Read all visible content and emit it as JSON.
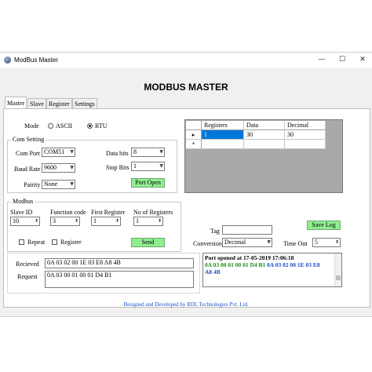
{
  "window": {
    "title": "ModBus Master",
    "controls": {
      "minimize": "—",
      "maximize": "☐",
      "close": "✕"
    }
  },
  "heading": "MODBUS MASTER",
  "tabs": [
    "Master",
    "Slave",
    "Register",
    "Settings"
  ],
  "mode": {
    "label": "Mode",
    "ascii": "ASCII",
    "rtu": "RTU",
    "selected": "RTU"
  },
  "com_setting": {
    "title": "Com Setting",
    "com_port_label": "Com Port",
    "com_port": "COM51",
    "baud_rate_label": "Baud Rate",
    "baud_rate": "9600",
    "pairity_label": "Pairity",
    "pairity": "None",
    "data_bits_label": "Data bits",
    "data_bits": "8",
    "stop_bits_label": "Stop Bits",
    "stop_bits": "1",
    "port_open_label": "Port Open"
  },
  "modbus": {
    "title": "Modbus",
    "slave_id_label": "Slave ID",
    "slave_id": "10",
    "function_code_label": "Function code",
    "function_code": "3",
    "first_register_label": "First Register",
    "first_register": "1",
    "no_of_registers_label": "No of Registers",
    "no_of_registers": "1",
    "repeat_label": "Repeat",
    "register_label": "Register",
    "send_label": "Send"
  },
  "grid": {
    "columns": [
      "Registers",
      "Data",
      "Decimal"
    ],
    "rows": [
      {
        "registers": "1",
        "data": "30",
        "decimal": "30"
      }
    ],
    "current_row_marker": "▸",
    "new_row_marker": "*"
  },
  "save_log_label": "Save Log",
  "tag": {
    "label": "Tag",
    "value": ""
  },
  "conversion": {
    "label": "Conversion",
    "value": "Decimal"
  },
  "time_out": {
    "label": "Time Out",
    "value": "5"
  },
  "recieved": {
    "label": "Recieved",
    "value": "0A 03 02 00 1E 03 E8 A8 4B"
  },
  "request": {
    "label": "Request",
    "value": "0A 03 00 01 00 01 D4 B1"
  },
  "log": {
    "line1": "Port opened at 17-05-2019 17:06:18",
    "line2_green": "0A 03 00 01 00 01 D4 B1",
    "line2_blue": "0A 03 02 00 1E 03 E8",
    "line3": "A8 4B"
  },
  "footer": "Designed and Developed by RDL Technologies Pvt. Ltd.",
  "colors": {
    "button_green": "#90ee90",
    "selection_blue": "#0078d7",
    "link_blue": "#1f4fd0",
    "log_green": "#1a8f1a"
  }
}
